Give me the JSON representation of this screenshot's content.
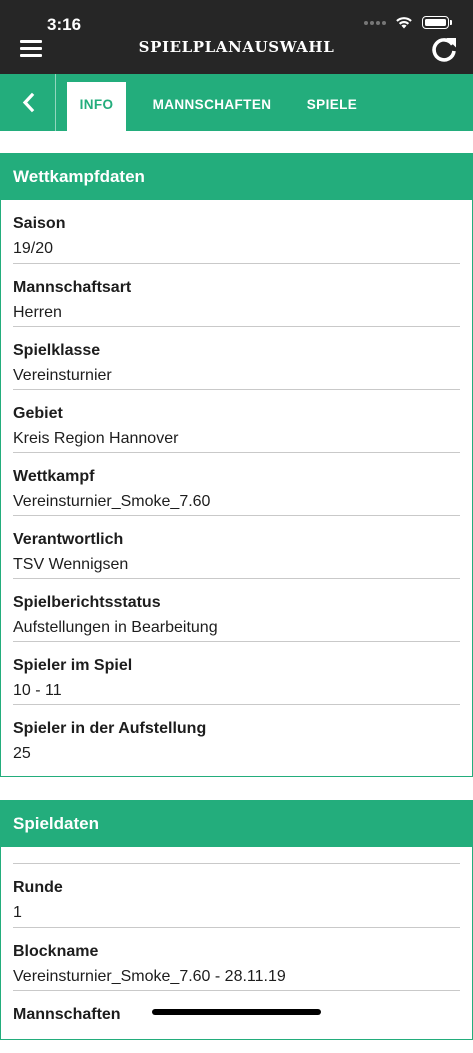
{
  "status_bar": {
    "time": "3:16"
  },
  "header": {
    "title": "SPIELPLANAUSWAHL"
  },
  "tabs": [
    {
      "label": "INFO",
      "active": true
    },
    {
      "label": "MANNSCHAFTEN",
      "active": false
    },
    {
      "label": "SPIELE",
      "active": false
    }
  ],
  "wettkampf": {
    "title": "Wettkampfdaten",
    "fields": [
      {
        "label": "Saison",
        "value": "19/20"
      },
      {
        "label": "Mannschaftsart",
        "value": "Herren"
      },
      {
        "label": "Spielklasse",
        "value": "Vereinsturnier"
      },
      {
        "label": "Gebiet",
        "value": "Kreis Region Hannover"
      },
      {
        "label": "Wettkampf",
        "value": "Vereinsturnier_Smoke_7.60"
      },
      {
        "label": "Verantwortlich",
        "value": "TSV Wennigsen"
      },
      {
        "label": "Spielberichtsstatus",
        "value": "Aufstellungen in Bearbeitung"
      },
      {
        "label": "Spieler im Spiel",
        "value": "10 - 11"
      },
      {
        "label": "Spieler in der Aufstellung",
        "value": "25"
      }
    ]
  },
  "spieldaten": {
    "title": "Spieldaten",
    "fields": [
      {
        "label": "Runde",
        "value": "1"
      },
      {
        "label": "Blockname",
        "value": "Vereinsturnier_Smoke_7.60 - 28.11.19"
      },
      {
        "label": "Mannschaften",
        "value": ""
      }
    ]
  },
  "colors": {
    "accent": "#23ad7c",
    "topbar": "#262626"
  },
  "icons": [
    "menu-icon",
    "refresh-icon",
    "back-chevron-icon",
    "wifi-icon",
    "battery-icon"
  ]
}
